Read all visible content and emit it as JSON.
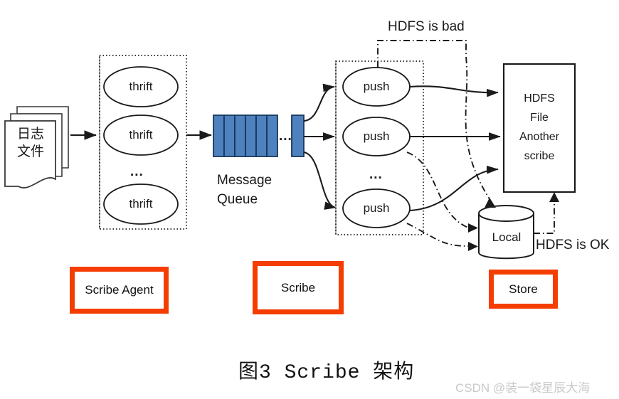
{
  "figure": {
    "caption": "图3 Scribe 架构",
    "watermark": "CSDN @装一袋星辰大海"
  },
  "colors": {
    "queue_fill": "#4E81BD",
    "queue_stroke": "#17365D",
    "red_box_border": "#F53D00",
    "line": "#1a1a1a",
    "watermark": "#c9c9c9"
  },
  "source": {
    "name": "log-files",
    "line1": "日志",
    "line2": "文件"
  },
  "agent_group": {
    "nodes": [
      {
        "label": "thrift"
      },
      {
        "label": "thrift"
      },
      {
        "label": "thrift"
      }
    ],
    "ellipsis": "...",
    "legend": "Scribe Agent"
  },
  "message_queue": {
    "label_line1": "Message",
    "label_line2": "Queue",
    "cells": 6,
    "tail_cells": 1,
    "ellipsis": "..."
  },
  "scribe_group": {
    "nodes": [
      {
        "label": "push"
      },
      {
        "label": "push"
      },
      {
        "label": "push"
      }
    ],
    "ellipsis": "...",
    "legend": "Scribe"
  },
  "store": {
    "hdfs_box": {
      "lines": [
        "HDFS",
        "File",
        "Another",
        "scribe"
      ]
    },
    "local_cylinder": {
      "label": "Local"
    },
    "legend": "Store"
  },
  "annotations": {
    "hdfs_is_bad": "HDFS is bad",
    "hdfs_is_ok": "HDFS is OK"
  }
}
